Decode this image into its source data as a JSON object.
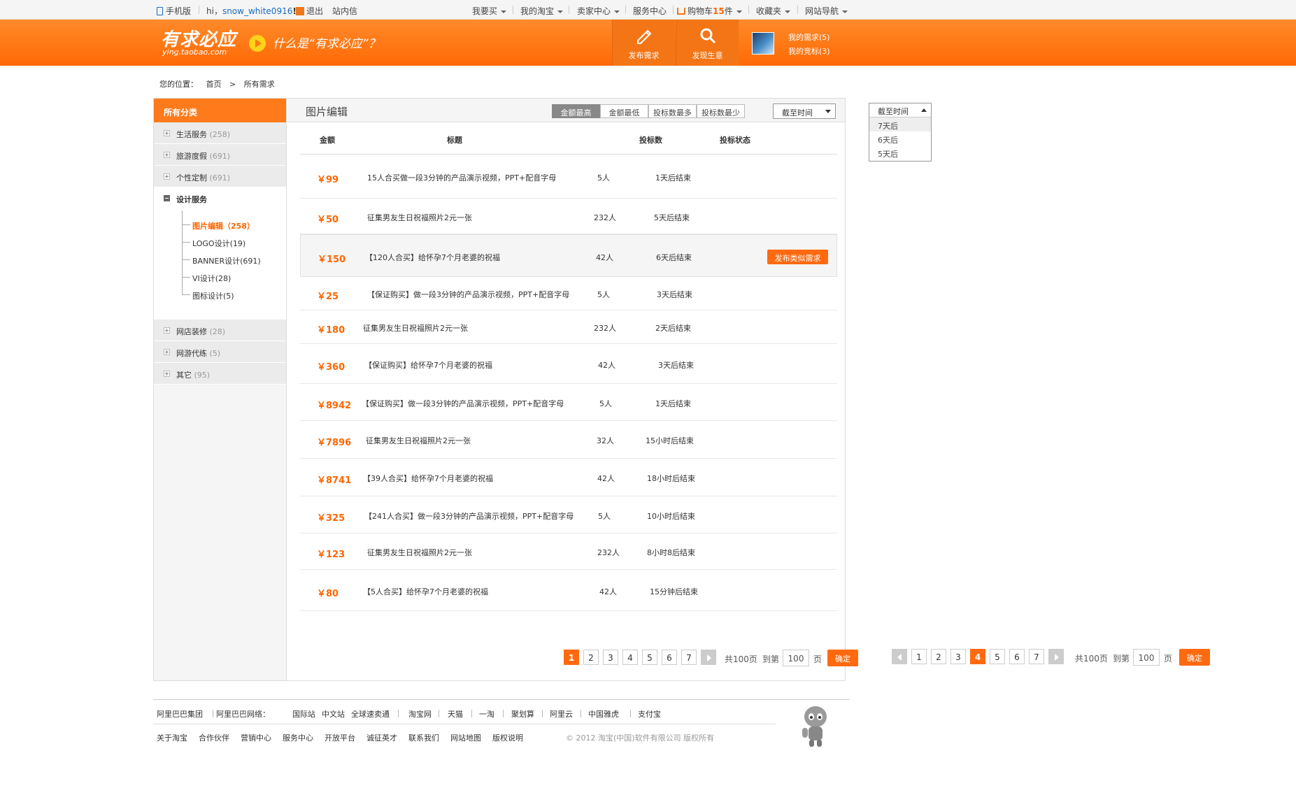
{
  "topbar": {
    "mobile": "手机版",
    "hi": "hi，",
    "username": "snow_white0916",
    "logout": "退出",
    "messages": "站内信",
    "buy": "我要买",
    "my_taobao": "我的淘宝",
    "seller": "卖家中心",
    "service": "服务中心",
    "cart_prefix": "购物车",
    "cart_count": "15",
    "cart_suffix": "件",
    "favorites": "收藏夹",
    "site_nav": "网站导航"
  },
  "header": {
    "logo": "有求必应",
    "logo_sub": "ying.taobao.com",
    "slogan": "什么是“有求必应”？",
    "publish_btn": "发布需求",
    "discover_btn": "发现生意",
    "my_demands": "我的需求(5)",
    "my_bids": "我的竞标(3)"
  },
  "breadcrumb": {
    "label": "您的位置：",
    "home": "首页",
    "current": "所有需求"
  },
  "sidebar": {
    "title": "所有分类",
    "cats_top": [
      {
        "name": "生活服务",
        "count": "(258)"
      },
      {
        "name": "旅游度假",
        "count": "(691)"
      },
      {
        "name": "个性定制",
        "count": "(691)"
      }
    ],
    "open_cat": "设计服务",
    "subcats": [
      "图片编辑（258）",
      "LOGO设计(19)",
      "BANNER设计(691)",
      " VI设计(28)",
      "图标设计(5)"
    ],
    "cats_bottom": [
      {
        "name": "网店装修",
        "count": "(28)"
      },
      {
        "name": "网游代练",
        "count": "(5)"
      },
      {
        "name": "其它",
        "count": "(95)"
      }
    ]
  },
  "content": {
    "title": "图片编辑",
    "sorts": [
      "金额最高",
      "金额最低",
      "投标数最多",
      "投标数最少"
    ],
    "deadline_label": "截至时间",
    "columns": {
      "price": "金额",
      "title": "标题",
      "bids": "投标数",
      "status": "投标状态"
    },
    "publish_similar": "发布类似需求",
    "rows": [
      {
        "price": "￥99",
        "title": "15人合买做一段3分钟的产品演示视频，PPT+配音字母",
        "bids": "5人",
        "status": "1天后结束"
      },
      {
        "price": "￥50",
        "title": "征集男友生日祝福照片2元一张",
        "bids": "232人",
        "status": "5天后结束"
      },
      {
        "price": "￥150",
        "title": "【120人合买】给怀孕7个月老婆的祝福",
        "bids": "42人",
        "status": "6天后结束"
      },
      {
        "price": "￥25",
        "title": "【保证购买】做一段3分钟的产品演示视频，PPT+配音字母",
        "bids": "5人",
        "status": "3天后结束"
      },
      {
        "price": "￥180",
        "title": "征集男友生日祝福照片2元一张",
        "bids": "232人",
        "status": "2天后结束"
      },
      {
        "price": "￥360",
        "title": "【保证购买】给怀孕7个月老婆的祝福",
        "bids": "42人",
        "status": "3天后结束"
      },
      {
        "price": "￥8942",
        "title": "【保证购买】做一段3分钟的产品演示视频，PPT+配音字母",
        "bids": "5人",
        "status": "1天后结束"
      },
      {
        "price": "￥7896",
        "title": "征集男友生日祝福照片2元一张",
        "bids": "32人",
        "status": "15小时后结束"
      },
      {
        "price": "￥8741",
        "title": "【39人合买】给怀孕7个月老婆的祝福",
        "bids": "42人",
        "status": "18小时后结束"
      },
      {
        "price": "￥325",
        "title": "【241人合买】做一段3分钟的产品演示视频，PPT+配音字母",
        "bids": "5人",
        "status": "10小时后结束"
      },
      {
        "price": "￥123",
        "title": "征集男友生日祝福照片2元一张",
        "bids": "232人",
        "status": "8小时8后结束"
      },
      {
        "price": "￥80",
        "title": "【5人合买】给怀孕7个月老婆的祝福",
        "bids": "42人",
        "status": "15分钟后结束"
      }
    ]
  },
  "pager1": {
    "pages": [
      "1",
      "2",
      "3",
      "4",
      "5",
      "6",
      "7"
    ],
    "current": 1,
    "total": "共100页",
    "goto": "到第",
    "input": "100",
    "page_unit": "页",
    "ok": "确定"
  },
  "pager2": {
    "pages": [
      "1",
      "2",
      "3",
      "4",
      "5",
      "6",
      "7"
    ],
    "current": 4,
    "total": "共100页",
    "goto": "到第",
    "input": "100",
    "page_unit": "页",
    "ok": "确定"
  },
  "dropdown": {
    "label": "截至时间",
    "options": [
      "7天后",
      "6天后",
      "5天后"
    ]
  },
  "footer": {
    "row1": [
      "阿里巴巴集团",
      "阿里巴巴网络：",
      "国际站",
      "中文站",
      "全球速卖通",
      "淘宝网",
      "天猫",
      "一淘",
      "聚划算",
      "阿里云",
      "中国雅虎",
      "支付宝"
    ],
    "row2": [
      "关于淘宝",
      "合作伙伴",
      "营销中心",
      "服务中心",
      "开放平台",
      "诚征英才",
      "联系我们",
      "网站地图",
      "版权说明"
    ],
    "copyright": "© 2012 淘宝(中国)软件有限公司 版权所有"
  },
  "colors": {
    "accent": "#ff6a10",
    "header": "#ff7a1a"
  }
}
